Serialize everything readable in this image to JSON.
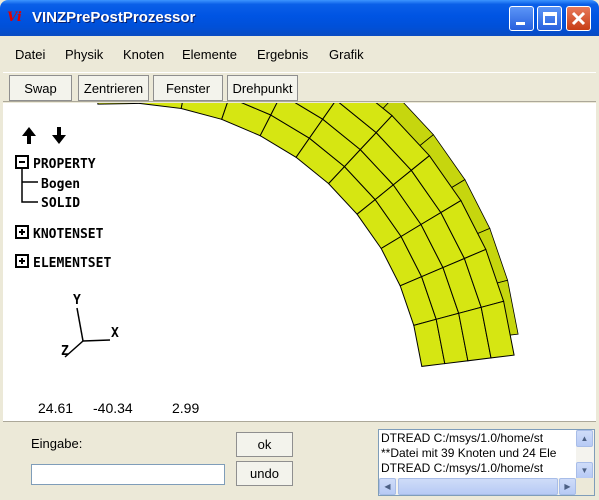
{
  "window": {
    "title": "VINZPrePostProzessor",
    "app_icon": "Vi",
    "controls": [
      "minimize-icon",
      "maximize-icon",
      "close-icon"
    ],
    "title_bar_color": "#0054e3"
  },
  "menu": {
    "items": [
      "Datei",
      "Physik",
      "Knoten",
      "Elemente",
      "Ergebnis",
      "Grafik"
    ]
  },
  "toolbar": {
    "buttons": [
      "Swap",
      "Zentrieren",
      "Fenster",
      "Drehpunkt"
    ]
  },
  "tree": {
    "property_label": "PROPERTY",
    "property_children": [
      "Bogen",
      "SOLID"
    ],
    "knotenset_label": "KNOTENSET",
    "elementset_label": "ELEMENTSET",
    "arrows": [
      "arrow-up-icon",
      "arrow-down-icon"
    ]
  },
  "axes": {
    "x": "X",
    "y": "Y",
    "z": "Z"
  },
  "coordinates": {
    "x": "24.61",
    "y": "-40.34",
    "z": "2.99"
  },
  "model": {
    "fill_color": "#d6e612",
    "edge_color": "#000000"
  },
  "input": {
    "label": "Eingabe:",
    "value": ""
  },
  "buttons": {
    "ok": "ok",
    "undo": "undo"
  },
  "log": {
    "lines": [
      "DTREAD C:/msys/1.0/home/st",
      "**Datei mit 39 Knoten und 24 Ele",
      "DTREAD C:/msys/1.0/home/st"
    ]
  }
}
